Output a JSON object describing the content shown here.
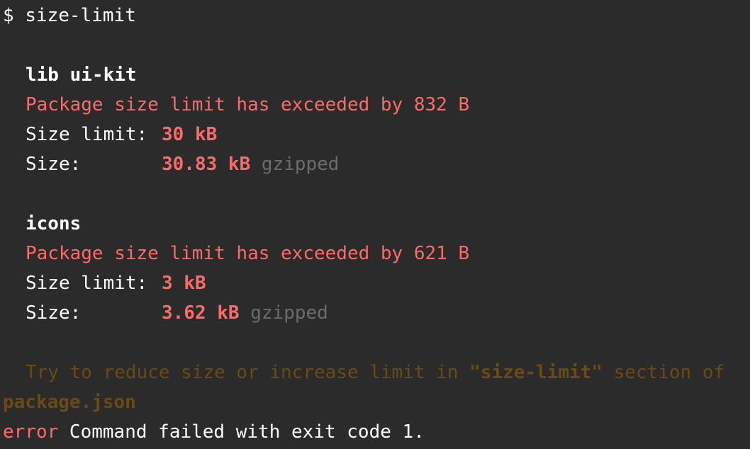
{
  "prompt": {
    "symbol": "$",
    "command": "size-limit"
  },
  "packages": [
    {
      "name": "lib ui-kit",
      "warning": "Package size limit has exceeded by 832 B",
      "limit_label": "Size limit:",
      "limit_value": "30 kB",
      "size_label": "Size:",
      "size_value": "30.83 kB",
      "size_suffix": "gzipped"
    },
    {
      "name": "icons",
      "warning": "Package size limit has exceeded by 621 B",
      "limit_label": "Size limit:",
      "limit_value": "3 kB",
      "size_label": "Size:",
      "size_value": "3.62 kB",
      "size_suffix": "gzipped"
    }
  ],
  "hint": {
    "before": "Try to reduce size or increase limit in ",
    "highlight": "\"size-limit\"",
    "after": " section of",
    "file": "package.json"
  },
  "error": {
    "keyword": "error",
    "message": " Command failed with exit code 1."
  },
  "colors": {
    "background": "#2b2b2b",
    "error_red": "#fb6b6b",
    "muted_gray": "#6c6c6c",
    "hint_brown": "#6b4a16",
    "text": "#ffffff"
  }
}
